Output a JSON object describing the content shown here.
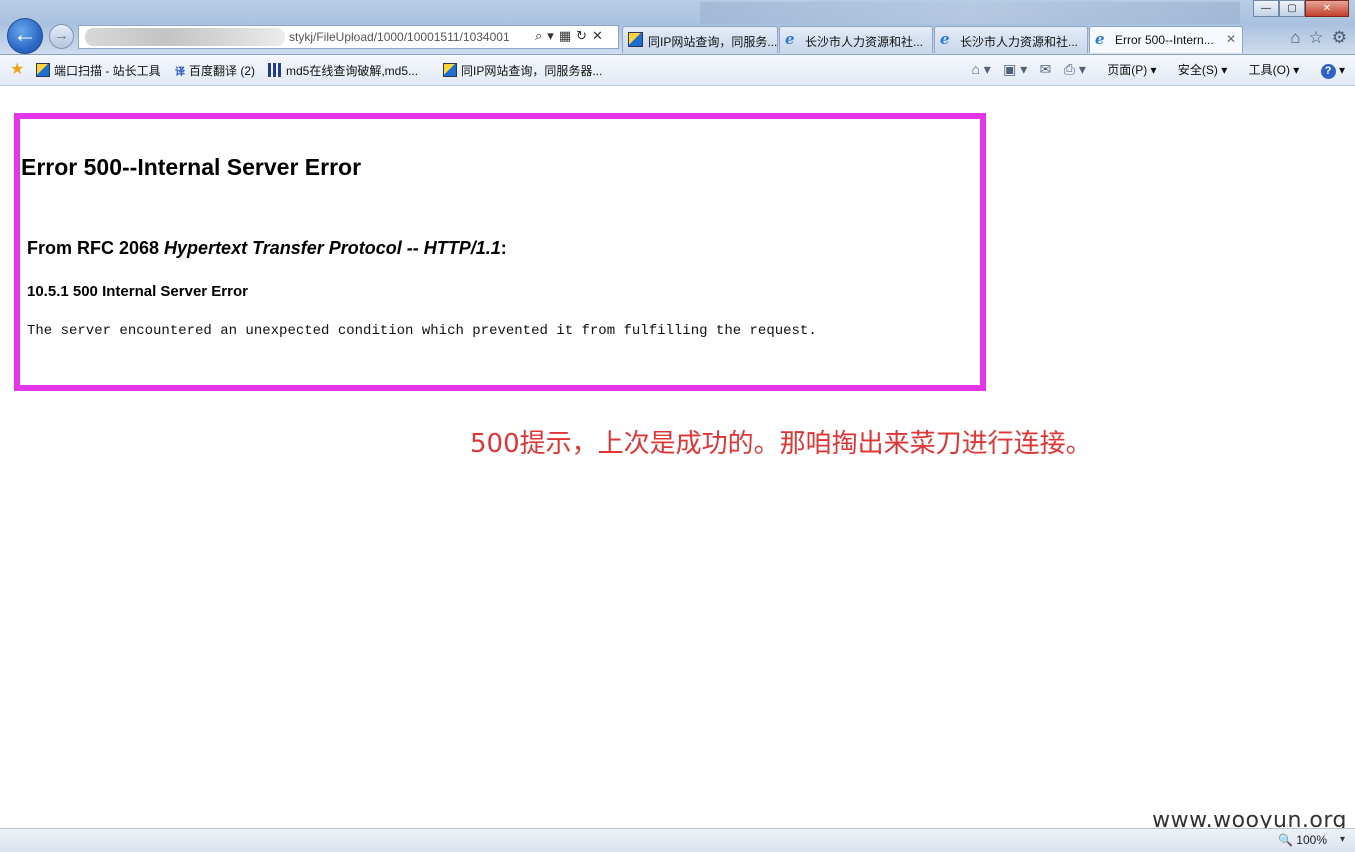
{
  "browser": {
    "address_url": "stykj/FileUpload/1000/10001511/1034001",
    "address_icons": [
      "search-icon",
      "dropdown-icon",
      "compat-icon",
      "refresh-icon",
      "stop-icon"
    ],
    "tabs": [
      {
        "label": "同IP网站查询，同服务...",
        "icon": "site-icon",
        "active": false
      },
      {
        "label": "长沙市人力资源和社...",
        "icon": "ie-icon",
        "active": false
      },
      {
        "label": "长沙市人力资源和社...",
        "icon": "ie-icon",
        "active": false
      },
      {
        "label": "Error 500--Intern...",
        "icon": "ie-icon",
        "active": true
      }
    ],
    "tab_close": "✕",
    "favorites": [
      {
        "label": "端口扫描 - 站长工具"
      },
      {
        "label": "百度翻译 (2)"
      },
      {
        "label": "md5在线查询破解,md5..."
      },
      {
        "label": "同IP网站查询，同服务器..."
      }
    ],
    "command_bar": {
      "page_label": "页面(P)",
      "safety_label": "安全(S)",
      "tools_label": "工具(O)"
    }
  },
  "page": {
    "error_title": "Error 500--Internal Server Error",
    "rfc_prefix": "From RFC 2068 ",
    "rfc_italic": "Hypertext Transfer Protocol -- HTTP/1.1",
    "rfc_suffix": ":",
    "section": "10.5.1 500 Internal Server Error",
    "message": "The server encountered an unexpected condition which prevented it from fulfilling the request.",
    "annotation": "500提示，上次是成功的。那咱掏出来菜刀进行连接。",
    "highlight_color": "#e535e8",
    "annotation_color": "#e03535"
  },
  "status": {
    "zoom": "100%",
    "watermark": "www.wooyun.org"
  }
}
